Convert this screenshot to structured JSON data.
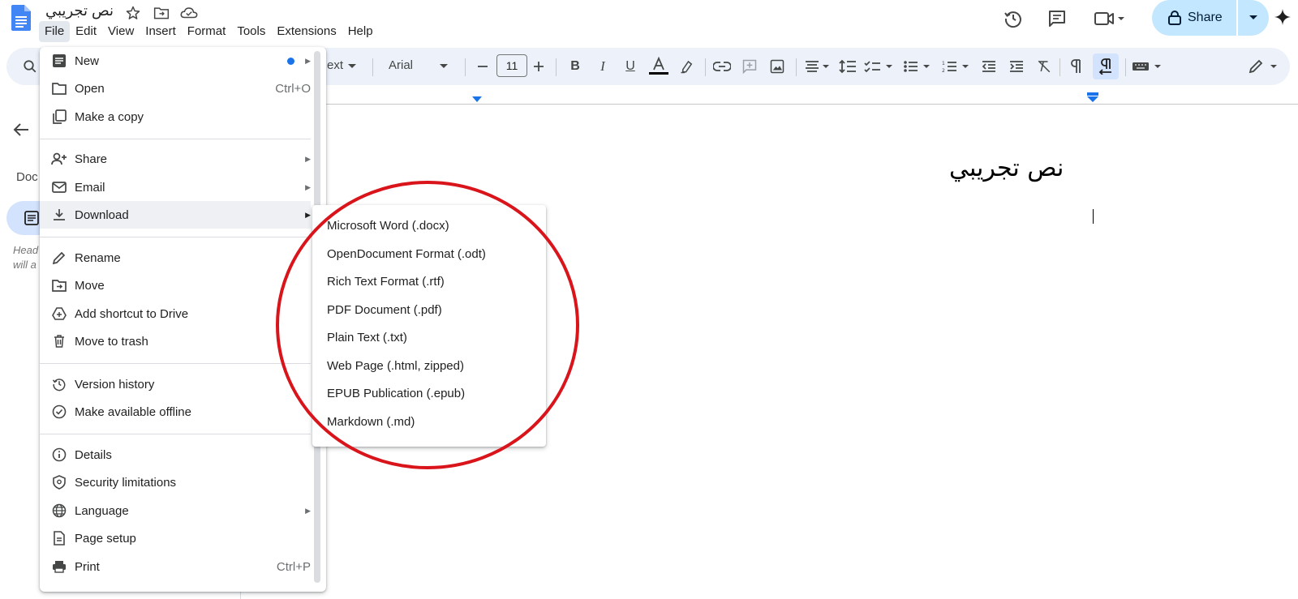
{
  "title_bar": {
    "doc_title": "نص تجريبي"
  },
  "menubar": [
    "File",
    "Edit",
    "View",
    "Insert",
    "Format",
    "Tools",
    "Extensions",
    "Help"
  ],
  "header": {
    "share_label": "Share"
  },
  "toolbar": {
    "style_text": "ext",
    "font_name": "Arial",
    "font_size": "11"
  },
  "left_panel": {
    "label": "Doc",
    "help_line1": "Head",
    "help_line2": "will a"
  },
  "document": {
    "heading": "نص تجريبي"
  },
  "file_menu": {
    "new": "New",
    "open": "Open",
    "open_shortcut": "Ctrl+O",
    "make_copy": "Make a copy",
    "share": "Share",
    "email": "Email",
    "download": "Download",
    "rename": "Rename",
    "move": "Move",
    "add_shortcut": "Add shortcut to Drive",
    "move_to_trash": "Move to trash",
    "version_history": "Version history",
    "make_offline": "Make available offline",
    "details": "Details",
    "security": "Security limitations",
    "language": "Language",
    "page_setup": "Page setup",
    "print": "Print",
    "print_shortcut": "Ctrl+P"
  },
  "download_menu": [
    "Microsoft Word (.docx)",
    "OpenDocument Format (.odt)",
    "Rich Text Format (.rtf)",
    "PDF Document (.pdf)",
    "Plain Text (.txt)",
    "Web Page (.html, zipped)",
    "EPUB Publication (.epub)",
    "Markdown (.md)"
  ],
  "colors": {
    "accent": "#1a73e8",
    "share_bg": "#c2e7ff",
    "toolbar_bg": "#edf2fa",
    "annotation": "#d9141b"
  }
}
